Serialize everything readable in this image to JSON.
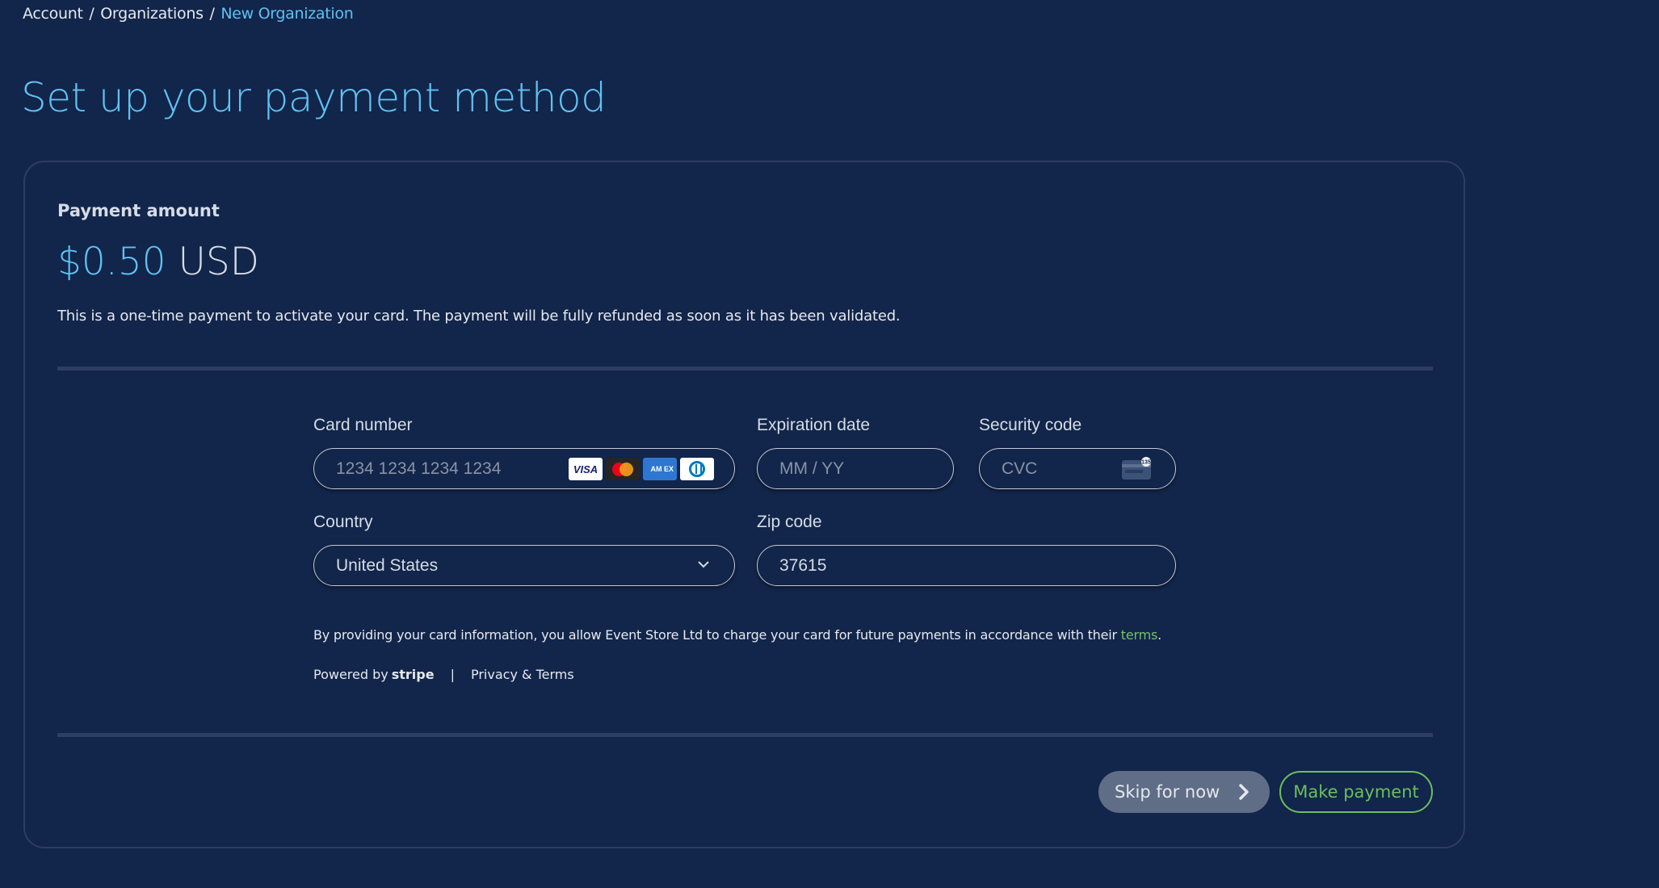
{
  "breadcrumb": {
    "items": [
      "Account",
      "Organizations"
    ],
    "separator": "/",
    "current": "New Organization"
  },
  "page": {
    "title": "Set up your payment method"
  },
  "payment": {
    "amount_label": "Payment amount",
    "amount_value": "$0.50",
    "currency": "USD",
    "description": "This is a one-time payment to activate your card. The payment will be fully refunded as soon as it has been validated."
  },
  "form": {
    "card_number": {
      "label": "Card number",
      "placeholder": "1234 1234 1234 1234",
      "value": ""
    },
    "card_brands": [
      {
        "name": "visa",
        "label": "VISA"
      },
      {
        "name": "mastercard",
        "label": ""
      },
      {
        "name": "amex",
        "label": "AM EX"
      },
      {
        "name": "diners",
        "label": ""
      }
    ],
    "expiration": {
      "label": "Expiration date",
      "placeholder": "MM / YY",
      "value": ""
    },
    "security_code": {
      "label": "Security code",
      "placeholder": "CVC",
      "value": "",
      "icon_hint": "135"
    },
    "country": {
      "label": "Country",
      "selected": "United States"
    },
    "zip": {
      "label": "Zip code",
      "value": "37615"
    },
    "consent_text": "By providing your card information, you allow Event Store Ltd to charge your card for future payments in accordance with their ",
    "consent_link": "terms",
    "consent_end": ".",
    "powered_by": "Powered by",
    "powered_brand": "stripe",
    "separator": "|",
    "privacy_link": "Privacy & Terms"
  },
  "actions": {
    "skip_label": "Skip for now",
    "pay_label": "Make payment"
  },
  "colors": {
    "background": "#12254a",
    "accent_blue": "#5fc2f2",
    "accent_green": "#6bbf5f",
    "skip_button": "#5f6d86"
  }
}
